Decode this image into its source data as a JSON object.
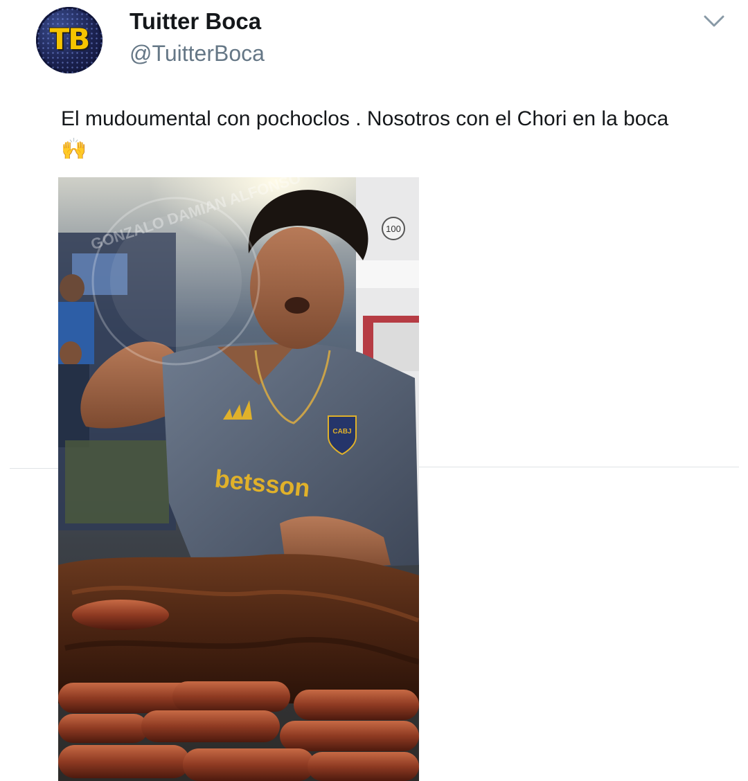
{
  "tweet": {
    "author_name": "Tuitter Boca",
    "author_handle": "@TuitterBoca",
    "avatar_text": "TB",
    "text": "El mudoumental con pochoclos . Nosotros con el Chori en la boca 🙌"
  },
  "media": {
    "shirt_text": "betsson",
    "crest_text": "CABJ",
    "bus_number": "100",
    "watermark_text": "GONZALO DAMIAN ALFONSO"
  },
  "icons": {
    "menu": "chevron-down-icon",
    "hands": "raising-hands-emoji"
  },
  "colors": {
    "name": "#14171a",
    "handle": "#657786",
    "divider": "#dfe3e6",
    "avatar_bg": "#1b2250",
    "avatar_text": "#f5c400"
  }
}
